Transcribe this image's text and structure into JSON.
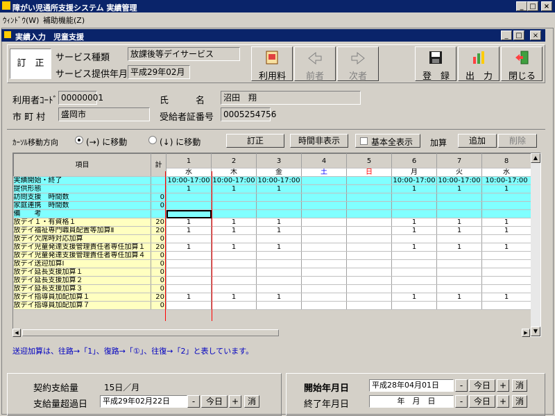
{
  "window": {
    "title": "障がい児通所支援システム 実績管理"
  },
  "menu": [
    "ｳｨﾝﾄﾞｳ(W)",
    "補助機能(Z)"
  ],
  "child": {
    "title": "実績入力　児童支援"
  },
  "mode_label": "訂　正",
  "service": {
    "type_label": "サービス種類",
    "type_value": "放課後等デイサービス",
    "month_label": "サービス提供年月",
    "month_value": "平成29年02月"
  },
  "toolbar": {
    "fee": "利用料",
    "prev": "前者",
    "next": "次者",
    "register": "登　録",
    "output": "出　力",
    "close": "閉じる"
  },
  "user": {
    "code_label": "利用者ｺｰﾄﾞ",
    "code_value": "00000001",
    "name_label": "氏　　　名",
    "name_value": "沼田　翔",
    "city_label": "市 町 村",
    "city_value": "盛岡市",
    "cert_label": "受給者証番号",
    "cert_value": "0005254756"
  },
  "options": {
    "cursor_label": "ｶｰｿﾙ移動方向",
    "right": "(→) に移動",
    "down": "(↓) に移動",
    "correct": "訂正",
    "hide_time": "時間非表示",
    "show_all": "基本全表示",
    "add_label": "加算",
    "add": "追加",
    "delete": "削除"
  },
  "grid": {
    "item_header": "項目",
    "total_header": "計",
    "days": [
      "1",
      "2",
      "3",
      "4",
      "5",
      "6",
      "7",
      "8"
    ],
    "weekdays": [
      "水",
      "木",
      "金",
      "土",
      "日",
      "月",
      "火",
      "水"
    ],
    "rows": [
      {
        "label": "実績開始・終了",
        "total": "",
        "cells": [
          "10:00-17:00",
          "10:00-17:00",
          "10:00-17:00",
          "",
          "",
          "10:00-17:00",
          "10:00-17:00",
          "10:00-17:00"
        ],
        "color": "cyan"
      },
      {
        "label": "提供形態",
        "total": "",
        "cells": [
          "1",
          "1",
          "1",
          "",
          "",
          "1",
          "1",
          "1"
        ],
        "color": "cyan"
      },
      {
        "label": "訪問支援　時間数",
        "total": "0",
        "cells": [
          "",
          "",
          "",
          "",
          "",
          "",
          "",
          ""
        ],
        "color": "cyan"
      },
      {
        "label": "家庭連携　時間数",
        "total": "0",
        "cells": [
          "",
          "",
          "",
          "",
          "",
          "",
          "",
          ""
        ],
        "color": "cyan"
      },
      {
        "label": "備　　考",
        "total": "",
        "cells": [
          "",
          "",
          "",
          "",
          "",
          "",
          "",
          ""
        ],
        "color": "cyan"
      },
      {
        "label": "放デイ１・有資格１",
        "total": "20",
        "cells": [
          "1",
          "1",
          "1",
          "",
          "",
          "1",
          "1",
          "1"
        ],
        "color": "yel"
      },
      {
        "label": "放デイ福祉専門職員配置等加算Ⅱ",
        "total": "20",
        "cells": [
          "1",
          "1",
          "1",
          "",
          "",
          "1",
          "1",
          "1"
        ],
        "color": "yel"
      },
      {
        "label": "放デイ欠席時対応加算",
        "total": "0",
        "cells": [
          "",
          "",
          "",
          "",
          "",
          "",
          "",
          ""
        ],
        "color": "yel"
      },
      {
        "label": "放デイ児童発達支援管理責任者専任加算１",
        "total": "20",
        "cells": [
          "1",
          "1",
          "1",
          "",
          "",
          "1",
          "1",
          "1"
        ],
        "color": "yel"
      },
      {
        "label": "放デイ児童発達支援管理責任者専任加算４",
        "total": "0",
        "cells": [
          "",
          "",
          "",
          "",
          "",
          "",
          "",
          ""
        ],
        "color": "yel"
      },
      {
        "label": "放デイ送迎加算Ⅰ",
        "total": "0",
        "cells": [
          "",
          "",
          "",
          "",
          "",
          "",
          "",
          ""
        ],
        "color": "yel"
      },
      {
        "label": "放デイ延長支援加算１",
        "total": "0",
        "cells": [
          "",
          "",
          "",
          "",
          "",
          "",
          "",
          ""
        ],
        "color": "yel"
      },
      {
        "label": "放デイ延長支援加算２",
        "total": "0",
        "cells": [
          "",
          "",
          "",
          "",
          "",
          "",
          "",
          ""
        ],
        "color": "yel"
      },
      {
        "label": "放デイ延長支援加算３",
        "total": "0",
        "cells": [
          "",
          "",
          "",
          "",
          "",
          "",
          "",
          ""
        ],
        "color": "yel"
      },
      {
        "label": "放デイ指導員加配加算１",
        "total": "20",
        "cells": [
          "1",
          "1",
          "1",
          "",
          "",
          "1",
          "1",
          "1"
        ],
        "color": "yel"
      },
      {
        "label": "放デイ指導員加配加算７",
        "total": "0",
        "cells": [
          "",
          "",
          "",
          "",
          "",
          "",
          "",
          ""
        ],
        "color": "yel"
      }
    ]
  },
  "note": "送迎加算は、往路→「1」、復路→「①」、往復→「2」と表しています。",
  "bottom": {
    "contract_label": "契約支給量",
    "contract_value": "15日／月",
    "excess_label": "支給量超過日",
    "excess_value": "平成29年02月22日",
    "today": "今日",
    "clear": "消",
    "start_label": "開始年月日",
    "start_value": "平成28年04月01日",
    "end_label": "終了年月日",
    "end_value": "　年　月　日"
  },
  "colors": {
    "title": "#0a246a",
    "cyan": "#80ffff",
    "yellow": "#ffffc0",
    "sat": "#0000ff",
    "sun": "#ff0000",
    "note": "#0000c0"
  }
}
